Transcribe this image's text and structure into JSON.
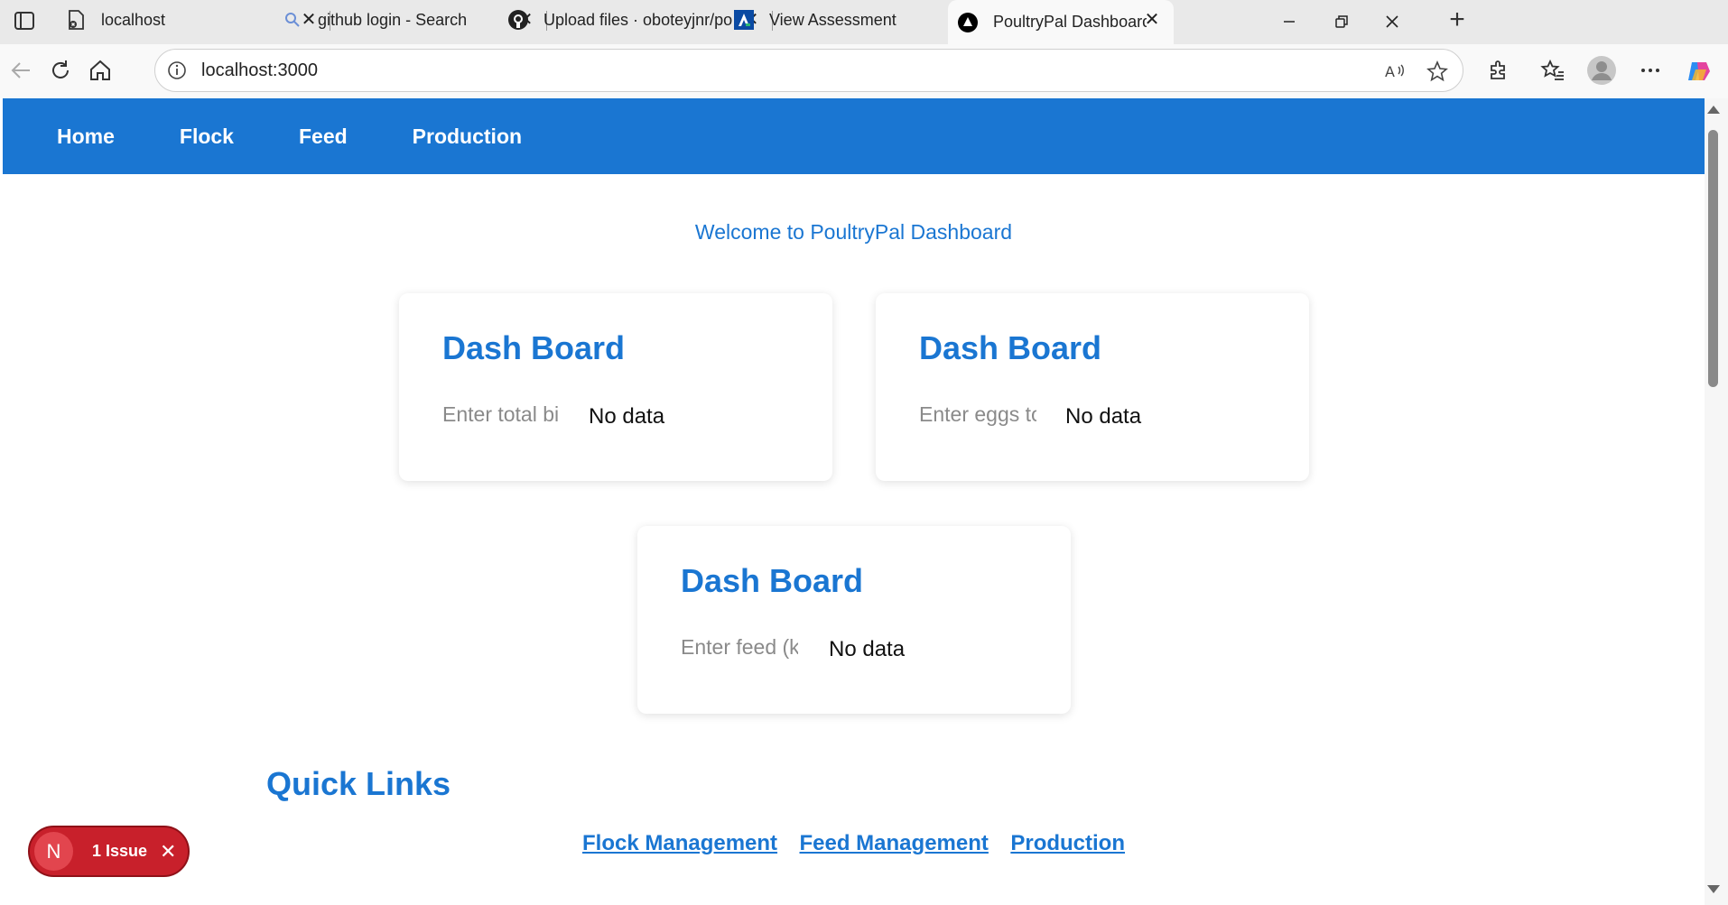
{
  "browser": {
    "tabs": [
      {
        "title": "localhost",
        "icon": "error-page-icon"
      },
      {
        "title": "github login - Search",
        "icon": "search-icon"
      },
      {
        "title": "Upload files · oboteyjnr/po",
        "icon": "github-icon"
      },
      {
        "title": "View Assessment",
        "icon": "assessment-icon"
      },
      {
        "title": "PoultryPal Dashboard",
        "icon": "nextjs-icon",
        "active": true
      }
    ],
    "url": "localhost:3000"
  },
  "app": {
    "nav": [
      "Home",
      "Flock",
      "Feed",
      "Production"
    ],
    "welcome": "Welcome to PoultryPal Dashboard",
    "cards": [
      {
        "title": "Dash Board",
        "placeholder": "Enter total birds",
        "value": "No data"
      },
      {
        "title": "Dash Board",
        "placeholder": "Enter eggs today",
        "value": "No data"
      },
      {
        "title": "Dash Board",
        "placeholder": "Enter feed (kg)",
        "value": "No data"
      }
    ],
    "quick_links_title": "Quick Links",
    "quick_links": [
      "Flock Management",
      "Feed Management",
      "Production"
    ]
  },
  "dev_overlay": {
    "letter": "N",
    "label": "1 Issue",
    "close": "✕"
  },
  "colors": {
    "accent": "#1a76d2",
    "issue_red": "#c8202b",
    "tabbar": "#e9e9e9"
  }
}
